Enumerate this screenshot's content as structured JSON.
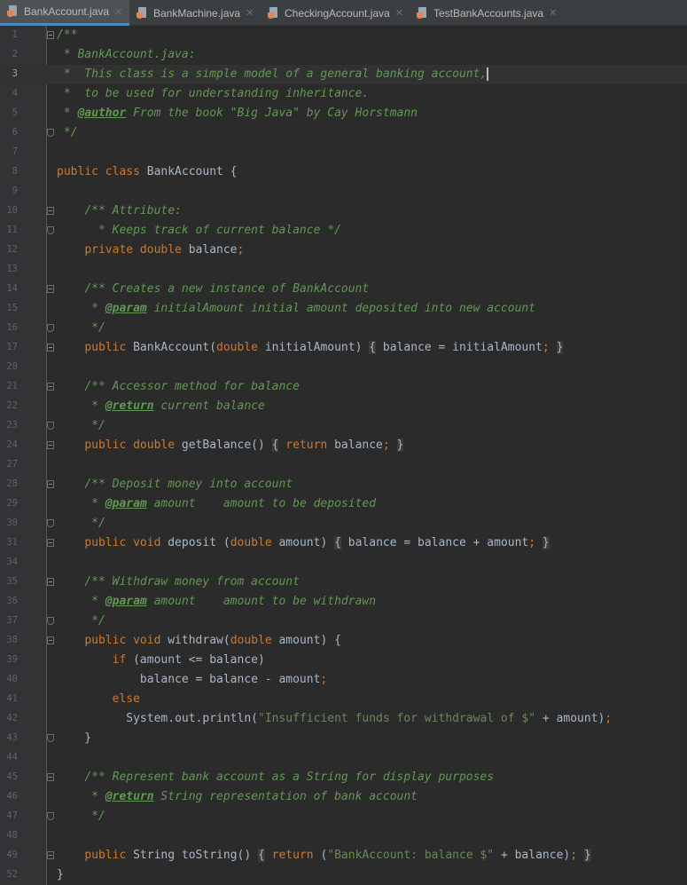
{
  "tabs": [
    {
      "label": "BankAccount.java",
      "active": true
    },
    {
      "label": "BankMachine.java",
      "active": false
    },
    {
      "label": "CheckingAccount.java",
      "active": false
    },
    {
      "label": "TestBankAccounts.java",
      "active": false
    }
  ],
  "current_line": "3",
  "lines": [
    {
      "n": "1",
      "fold": "open",
      "tokens": [
        [
          "cm",
          "/**"
        ]
      ]
    },
    {
      "n": "2",
      "tokens": [
        [
          "cm",
          " * BankAccount.java:"
        ]
      ]
    },
    {
      "n": "3",
      "tokens": [
        [
          "cm",
          " *  This class is a simple model of a general banking account,"
        ],
        [
          "cursor",
          ""
        ]
      ]
    },
    {
      "n": "4",
      "tokens": [
        [
          "cm",
          " *  to be used for understanding inheritance."
        ]
      ]
    },
    {
      "n": "5",
      "tokens": [
        [
          "cm",
          " * "
        ],
        [
          "tag",
          "@author"
        ],
        [
          "cm",
          " From the book \"Big Java\" by Cay Horstmann"
        ]
      ]
    },
    {
      "n": "6",
      "fold": "close",
      "tokens": [
        [
          "cm",
          " */"
        ]
      ]
    },
    {
      "n": "7",
      "tokens": []
    },
    {
      "n": "8",
      "tokens": [
        [
          "kw",
          "public class "
        ],
        [
          "p",
          "BankAccount {"
        ]
      ]
    },
    {
      "n": "9",
      "tokens": []
    },
    {
      "n": "10",
      "fold": "open",
      "tokens": [
        [
          "p",
          "    "
        ],
        [
          "cm",
          "/** Attribute:"
        ]
      ]
    },
    {
      "n": "11",
      "fold": "close",
      "tokens": [
        [
          "cm",
          "      * Keeps track of current balance */"
        ]
      ]
    },
    {
      "n": "12",
      "tokens": [
        [
          "p",
          "    "
        ],
        [
          "kw",
          "private double "
        ],
        [
          "p",
          "balance"
        ],
        [
          "kw",
          ";"
        ]
      ]
    },
    {
      "n": "13",
      "tokens": []
    },
    {
      "n": "14",
      "fold": "open",
      "tokens": [
        [
          "p",
          "    "
        ],
        [
          "cm",
          "/** Creates a new instance of BankAccount"
        ]
      ]
    },
    {
      "n": "15",
      "tokens": [
        [
          "cm",
          "     * "
        ],
        [
          "tag",
          "@param"
        ],
        [
          "cm",
          " initialAmount initial amount deposited into new account"
        ]
      ]
    },
    {
      "n": "16",
      "fold": "close",
      "tokens": [
        [
          "cm",
          "     */"
        ]
      ]
    },
    {
      "n": "17",
      "fold": "open",
      "tokens": [
        [
          "p",
          "    "
        ],
        [
          "kw",
          "public "
        ],
        [
          "p",
          "BankAccount("
        ],
        [
          "kw",
          "double "
        ],
        [
          "p",
          "initialAmount) "
        ],
        [
          "box",
          "{"
        ],
        [
          "p",
          " balance = initialAmount"
        ],
        [
          "kw",
          ";"
        ],
        [
          "p",
          " "
        ],
        [
          "box",
          "}"
        ]
      ]
    },
    {
      "n": "20",
      "tokens": []
    },
    {
      "n": "21",
      "fold": "open",
      "tokens": [
        [
          "p",
          "    "
        ],
        [
          "cm",
          "/** Accessor method for balance"
        ]
      ]
    },
    {
      "n": "22",
      "tokens": [
        [
          "cm",
          "     * "
        ],
        [
          "tag",
          "@return"
        ],
        [
          "cm",
          " current balance"
        ]
      ]
    },
    {
      "n": "23",
      "fold": "close",
      "tokens": [
        [
          "cm",
          "     */"
        ]
      ]
    },
    {
      "n": "24",
      "fold": "open",
      "tokens": [
        [
          "p",
          "    "
        ],
        [
          "kw",
          "public double "
        ],
        [
          "p",
          "getBalance() "
        ],
        [
          "box",
          "{"
        ],
        [
          "p",
          " "
        ],
        [
          "kw",
          "return "
        ],
        [
          "p",
          "balance"
        ],
        [
          "kw",
          ";"
        ],
        [
          "p",
          " "
        ],
        [
          "box",
          "}"
        ]
      ]
    },
    {
      "n": "27",
      "tokens": []
    },
    {
      "n": "28",
      "fold": "open",
      "tokens": [
        [
          "p",
          "    "
        ],
        [
          "cm",
          "/** Deposit money into account"
        ]
      ]
    },
    {
      "n": "29",
      "tokens": [
        [
          "cm",
          "     * "
        ],
        [
          "tag",
          "@param"
        ],
        [
          "cm",
          " amount    amount to be deposited"
        ]
      ]
    },
    {
      "n": "30",
      "fold": "close",
      "tokens": [
        [
          "cm",
          "     */"
        ]
      ]
    },
    {
      "n": "31",
      "fold": "open",
      "tokens": [
        [
          "p",
          "    "
        ],
        [
          "kw",
          "public void "
        ],
        [
          "p",
          "deposit ("
        ],
        [
          "kw",
          "double "
        ],
        [
          "p",
          "amount) "
        ],
        [
          "box",
          "{"
        ],
        [
          "p",
          " balance = balance + amount"
        ],
        [
          "kw",
          ";"
        ],
        [
          "p",
          " "
        ],
        [
          "box",
          "}"
        ]
      ]
    },
    {
      "n": "34",
      "tokens": []
    },
    {
      "n": "35",
      "fold": "open",
      "tokens": [
        [
          "p",
          "    "
        ],
        [
          "cm",
          "/** Withdraw money from account"
        ]
      ]
    },
    {
      "n": "36",
      "tokens": [
        [
          "cm",
          "     * "
        ],
        [
          "tag",
          "@param"
        ],
        [
          "cm",
          " amount    amount to be withdrawn"
        ]
      ]
    },
    {
      "n": "37",
      "fold": "close",
      "tokens": [
        [
          "cm",
          "     */"
        ]
      ]
    },
    {
      "n": "38",
      "fold": "open",
      "tokens": [
        [
          "p",
          "    "
        ],
        [
          "kw",
          "public void "
        ],
        [
          "p",
          "withdraw("
        ],
        [
          "kw",
          "double "
        ],
        [
          "p",
          "amount) {"
        ]
      ]
    },
    {
      "n": "39",
      "tokens": [
        [
          "p",
          "        "
        ],
        [
          "kw",
          "if "
        ],
        [
          "p",
          "(amount <= balance)"
        ]
      ]
    },
    {
      "n": "40",
      "tokens": [
        [
          "p",
          "            balance = balance - amount"
        ],
        [
          "kw",
          ";"
        ]
      ]
    },
    {
      "n": "41",
      "tokens": [
        [
          "p",
          "        "
        ],
        [
          "kw",
          "else"
        ]
      ]
    },
    {
      "n": "42",
      "tokens": [
        [
          "p",
          "          System."
        ],
        [
          "p",
          "out"
        ],
        [
          "p",
          ".println("
        ],
        [
          "str",
          "\"Insufficient funds for withdrawal of $\""
        ],
        [
          "p",
          " + amount)"
        ],
        [
          "kw",
          ";"
        ]
      ]
    },
    {
      "n": "43",
      "fold": "close",
      "tokens": [
        [
          "p",
          "    }"
        ]
      ]
    },
    {
      "n": "44",
      "tokens": []
    },
    {
      "n": "45",
      "fold": "open",
      "tokens": [
        [
          "p",
          "    "
        ],
        [
          "cm",
          "/** Represent bank account as a String for display purposes"
        ]
      ]
    },
    {
      "n": "46",
      "tokens": [
        [
          "cm",
          "     * "
        ],
        [
          "tag",
          "@return"
        ],
        [
          "cm",
          " String representation of bank account"
        ]
      ]
    },
    {
      "n": "47",
      "fold": "close",
      "tokens": [
        [
          "cm",
          "     */"
        ]
      ]
    },
    {
      "n": "48",
      "tokens": []
    },
    {
      "n": "49",
      "fold": "open",
      "tokens": [
        [
          "p",
          "    "
        ],
        [
          "kw",
          "public "
        ],
        [
          "p",
          "String toString() "
        ],
        [
          "box",
          "{"
        ],
        [
          "p",
          " "
        ],
        [
          "kw",
          "return "
        ],
        [
          "p",
          "("
        ],
        [
          "str",
          "\"BankAccount: balance $\""
        ],
        [
          "p",
          " + balance)"
        ],
        [
          "kw",
          ";"
        ],
        [
          "p",
          " "
        ],
        [
          "box",
          "}"
        ]
      ]
    },
    {
      "n": "52",
      "tokens": [
        [
          "p",
          "}"
        ]
      ]
    }
  ]
}
